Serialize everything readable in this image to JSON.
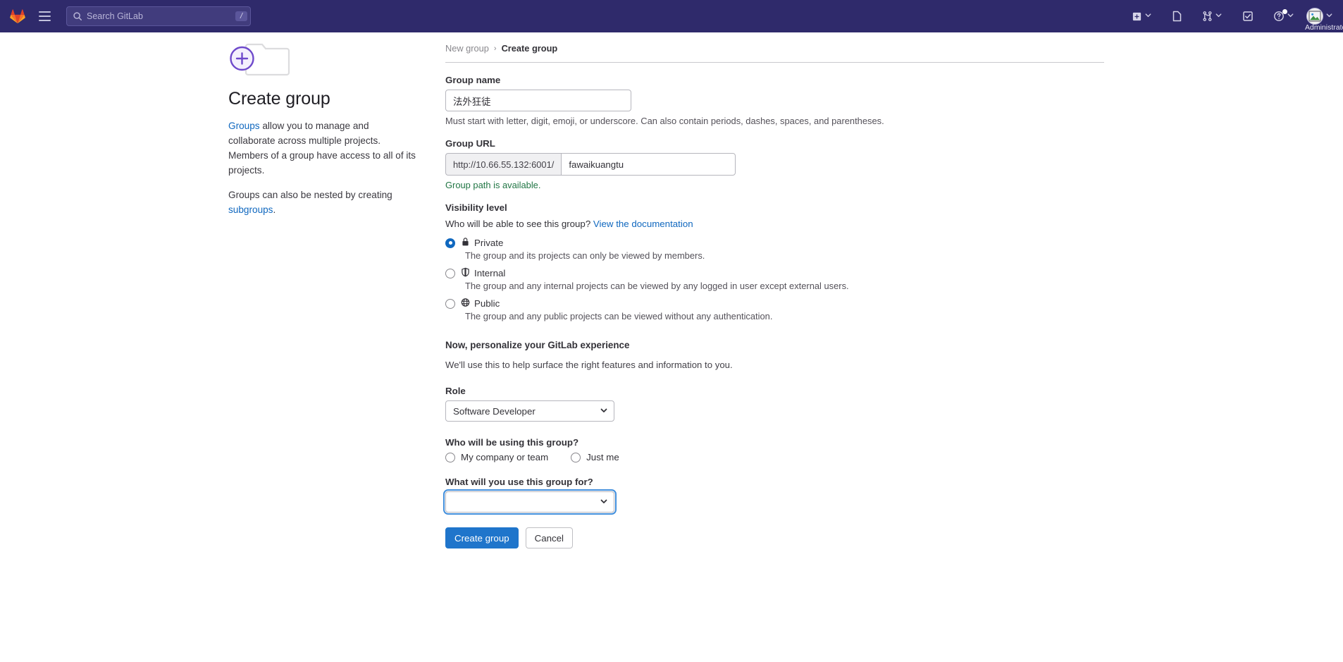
{
  "topbar": {
    "logo_icon": "gitlab-fox-logo",
    "hamburger_icon": "hamburger-menu-icon",
    "search": {
      "icon": "search-icon",
      "placeholder": "Search GitLab",
      "shortcut_badge": "/"
    },
    "actions": [
      {
        "icon": "plus-square-icon",
        "has_chevron": true
      },
      {
        "icon": "issues-page-icon",
        "has_chevron": false
      },
      {
        "icon": "merge-request-icon",
        "has_chevron": true
      },
      {
        "icon": "todo-checkbox-icon",
        "has_chevron": false
      },
      {
        "icon": "help-question-icon",
        "has_chevron": true,
        "notification_dot": true
      }
    ],
    "user": {
      "avatar_icon": "broken-image-avatar-icon",
      "name": "Administrato",
      "chevron_icon": "chevron-down-icon"
    },
    "background_color": "#2f2a6b"
  },
  "intro": {
    "icon": "new-group-folder-plus-icon",
    "title": "Create group",
    "paragraph1_link": "Groups",
    "paragraph1_rest": " allow you to manage and collaborate across multiple projects. Members of a group have access to all of its projects.",
    "paragraph2_pre": "Groups can also be nested by creating ",
    "paragraph2_link": "subgroups",
    "paragraph2_post": "."
  },
  "breadcrumb": {
    "parent": "New group",
    "separator": "›",
    "current": "Create group"
  },
  "form": {
    "group_name": {
      "label": "Group name",
      "value": "法外狂徒",
      "hint": "Must start with letter, digit, emoji, or underscore. Can also contain periods, dashes, spaces, and parentheses."
    },
    "group_url": {
      "label": "Group URL",
      "prefix": "http://10.66.55.132:6001/",
      "value": "fawaikuangtu",
      "availability": "Group path is available.",
      "availability_color": "#217645"
    },
    "visibility": {
      "label": "Visibility level",
      "question": "Who will be able to see this group?",
      "doc_link": "View the documentation",
      "options": [
        {
          "id": "private",
          "icon": "lock-icon",
          "label": "Private",
          "description": "The group and its projects can only be viewed by members.",
          "selected": true
        },
        {
          "id": "internal",
          "icon": "shield-icon",
          "label": "Internal",
          "description": "The group and any internal projects can be viewed by any logged in user except external users.",
          "selected": false
        },
        {
          "id": "public",
          "icon": "globe-icon",
          "label": "Public",
          "description": "The group and any public projects can be viewed without any authentication.",
          "selected": false
        }
      ]
    },
    "personalize": {
      "heading": "Now, personalize your GitLab experience",
      "subtext": "We'll use this to help surface the right features and information to you."
    },
    "role": {
      "label": "Role",
      "value": "Software Developer",
      "chevron_icon": "chevron-down-icon"
    },
    "who_using": {
      "label": "Who will be using this group?",
      "options": [
        {
          "id": "company",
          "label": "My company or team",
          "selected": false
        },
        {
          "id": "just-me",
          "label": "Just me",
          "selected": false
        }
      ]
    },
    "use_for": {
      "label": "What will you use this group for?",
      "value": "",
      "focused": true,
      "chevron_icon": "chevron-down-icon"
    },
    "buttons": {
      "submit": "Create group",
      "cancel": "Cancel",
      "submit_color": "#1f75cb"
    }
  }
}
